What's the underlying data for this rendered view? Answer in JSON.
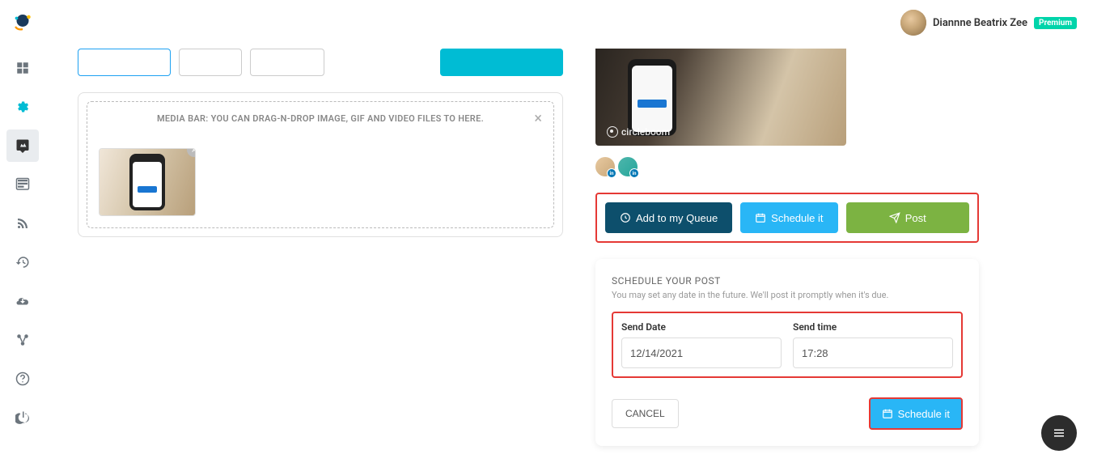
{
  "user": {
    "name": "Diannne Beatrix Zee",
    "badge": "Premium"
  },
  "media_bar": {
    "label": "MEDIA BAR: YOU CAN DRAG-N-DROP IMAGE, GIF AND VIDEO FILES TO HERE."
  },
  "preview": {
    "watermark": "circleboom"
  },
  "actions": {
    "queue": "Add to my Queue",
    "schedule": "Schedule it",
    "post": "Post"
  },
  "schedule": {
    "title": "SCHEDULE YOUR POST",
    "subtitle": "You may set any date in the future. We'll post it promptly when it's due.",
    "date_label": "Send Date",
    "date_value": "12/14/2021",
    "time_label": "Send time",
    "time_value": "17:28",
    "cancel": "CANCEL",
    "confirm": "Schedule it"
  }
}
